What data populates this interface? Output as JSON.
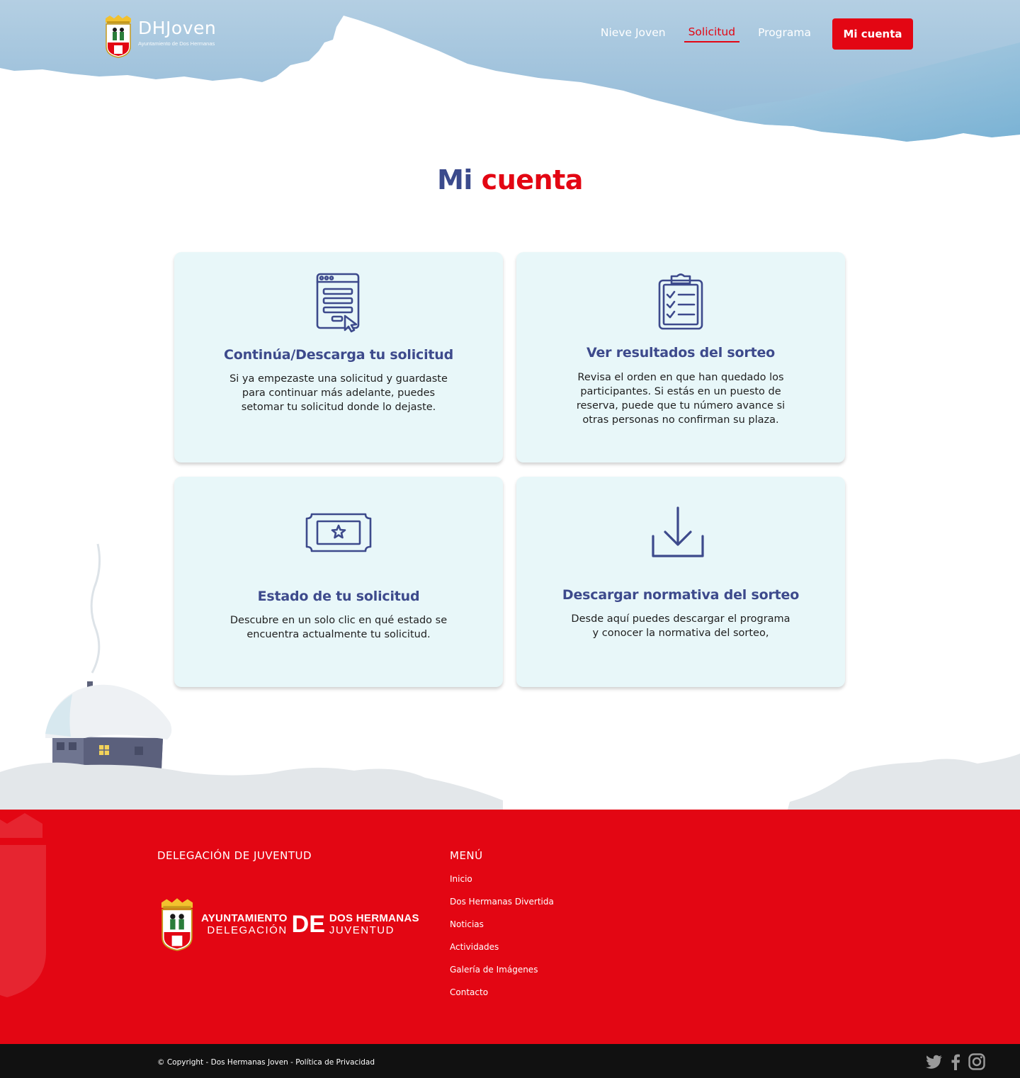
{
  "header": {
    "logo_title": "DHJoven",
    "logo_subtitle": "Ayuntamiento de Dos Hermanas",
    "nav": [
      {
        "label": "Nieve Joven"
      },
      {
        "label": "Solicitud"
      },
      {
        "label": "Programa"
      }
    ],
    "active_nav": "Solicitud",
    "cta_label": "Mi cuenta"
  },
  "page_title": {
    "part1": "Mi",
    "part2": "cuenta"
  },
  "cards": [
    {
      "icon": "browser-click-icon",
      "title": "Continúa/Descarga  tu solicitud",
      "desc": [
        "Si ya empezaste una solicitud y guardaste",
        "para continuar más adelante, puedes",
        "setomar tu solicitud donde lo dejaste."
      ]
    },
    {
      "icon": "clipboard-checklist-icon",
      "title": "Ver resultados del sorteo",
      "desc": [
        "Revisa el orden en que han quedado los",
        "participantes. Si estás en un puesto de",
        "reserva, puede que tu número avance si",
        "otras personas no confirman su plaza."
      ]
    },
    {
      "icon": "ticket-star-icon",
      "title": "Estado de  tu solicitud",
      "desc": [
        "Descubre en un solo clic en qué estado se",
        "encuentra actualmente tu solicitud."
      ]
    },
    {
      "icon": "download-icon",
      "title": "Descargar normativa del sorteo",
      "desc": [
        "Desde aquí puedes descargar el programa",
        "y conocer la normativa del sorteo,"
      ]
    }
  ],
  "footer": {
    "col1_heading": "DELEGACIÓN DE JUVENTUD",
    "col2_heading": "MENÚ",
    "logo_ayuntamiento": "AYUNTAMIENTO",
    "logo_delegacion": "DELEGACIÓN",
    "logo_de": "DE",
    "logo_dos_hermanas": "DOS HERMANAS",
    "logo_juventud": "JUVENTUD",
    "menu": [
      "Inicio",
      "Dos Hermanas Divertida",
      "Noticias",
      "Actividades",
      "Galería de Imágenes",
      "Contacto"
    ],
    "copyright": "© Copyright - Dos Hermanas Joven - Política de Privacidad",
    "socials": [
      "twitter-icon",
      "facebook-icon",
      "instagram-icon"
    ]
  },
  "colors": {
    "brand_red": "#e30613",
    "brand_navy": "#3b4a8c",
    "card_bg": "#e8f7f9",
    "sky_blue": "#a9c9e0",
    "footer_bottom": "#111111"
  }
}
